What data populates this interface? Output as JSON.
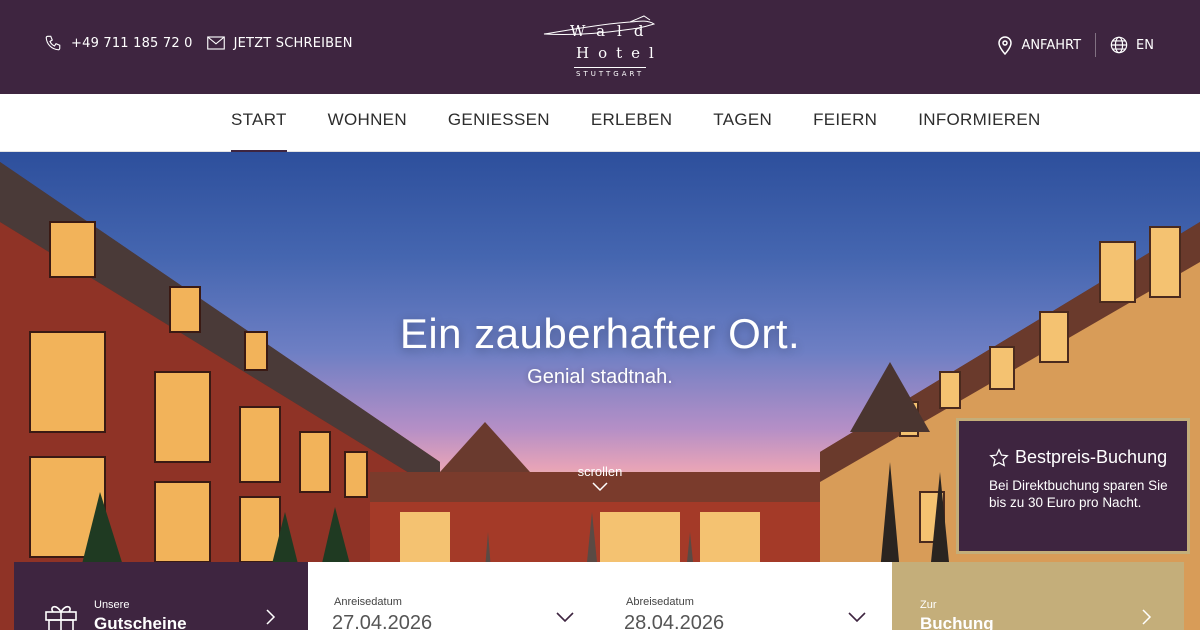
{
  "topbar": {
    "phone": "+49 711 185 72 0",
    "write": "JETZT SCHREIBEN",
    "directions": "ANFAHRT",
    "language": "EN"
  },
  "logo": {
    "line1": "Wald",
    "line2": "Hotel",
    "line3": "STUTTGART"
  },
  "nav": {
    "items": [
      {
        "label": "START",
        "active": true
      },
      {
        "label": "WOHNEN"
      },
      {
        "label": "GENIESSEN"
      },
      {
        "label": "ERLEBEN"
      },
      {
        "label": "TAGEN"
      },
      {
        "label": "FEIERN"
      },
      {
        "label": "INFORMIEREN"
      }
    ]
  },
  "hero": {
    "headline": "Ein zauberhafter Ort.",
    "subline": "Genial stadtnah.",
    "scroll": "scrollen"
  },
  "bestprice": {
    "title": "Bestpreis-Buchung",
    "text": "Bei Direktbuchung sparen Sie bis zu 30 Euro pro Nacht."
  },
  "booking": {
    "gift_small": "Unsere",
    "gift_big": "Gutscheine",
    "arrival_label": "Anreisedatum",
    "arrival_value": "27.04.2026",
    "departure_label": "Abreisedatum",
    "departure_value": "28.04.2026",
    "book_small": "Zur",
    "book_big": "Buchung"
  },
  "colors": {
    "brand_purple": "#3e2540",
    "gold": "#c4ae7a"
  }
}
